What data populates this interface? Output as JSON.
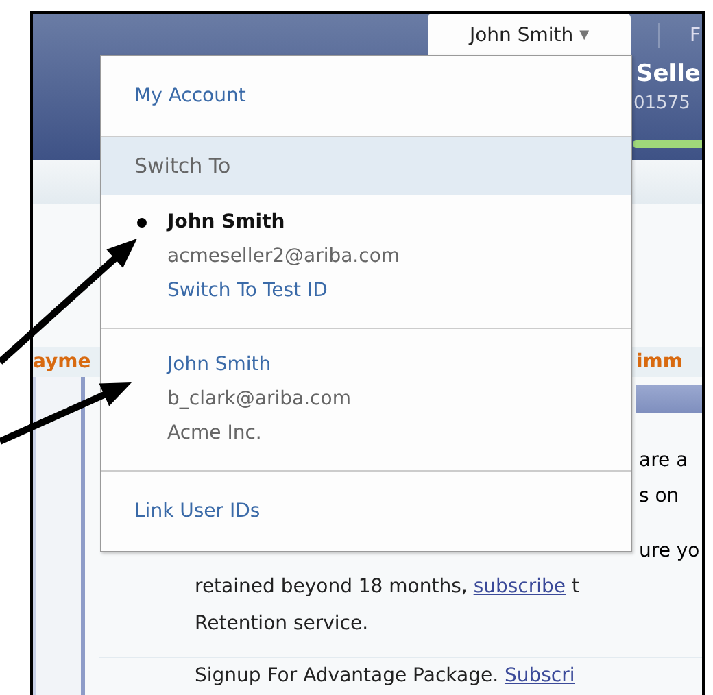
{
  "header": {
    "user_menu": {
      "label": "John Smith",
      "caret": "▼",
      "expanded": true
    },
    "nav_fragment": "F",
    "title_fragment": "Selle",
    "id_fragment": "01575"
  },
  "user_dropdown": {
    "my_account": "My Account",
    "section_title": "Switch To",
    "accounts": [
      {
        "name": "John Smith",
        "email": "acmeseller2@ariba.com",
        "link": "Switch To Test ID",
        "selected": true
      },
      {
        "name": "John Smith",
        "email": "b_clark@ariba.com",
        "company": "Acme Inc.",
        "selected": false
      }
    ],
    "link_user_ids": "Link User IDs"
  },
  "page": {
    "left_heading_fragment": "ayme",
    "right_heading_fragment": "imm",
    "right_fragments": [
      "are a",
      "s on",
      "ure yo"
    ],
    "lines": [
      {
        "text": "retained beyond 18 months, ",
        "link": "subscribe",
        "rest": " t"
      },
      {
        "text": "Retention service."
      },
      {
        "text": "Signup For Advantage Package. ",
        "link": "Subscri"
      }
    ]
  },
  "annotations": {
    "arrows": [
      {
        "kind": "arrow"
      },
      {
        "kind": "arrow"
      }
    ]
  }
}
